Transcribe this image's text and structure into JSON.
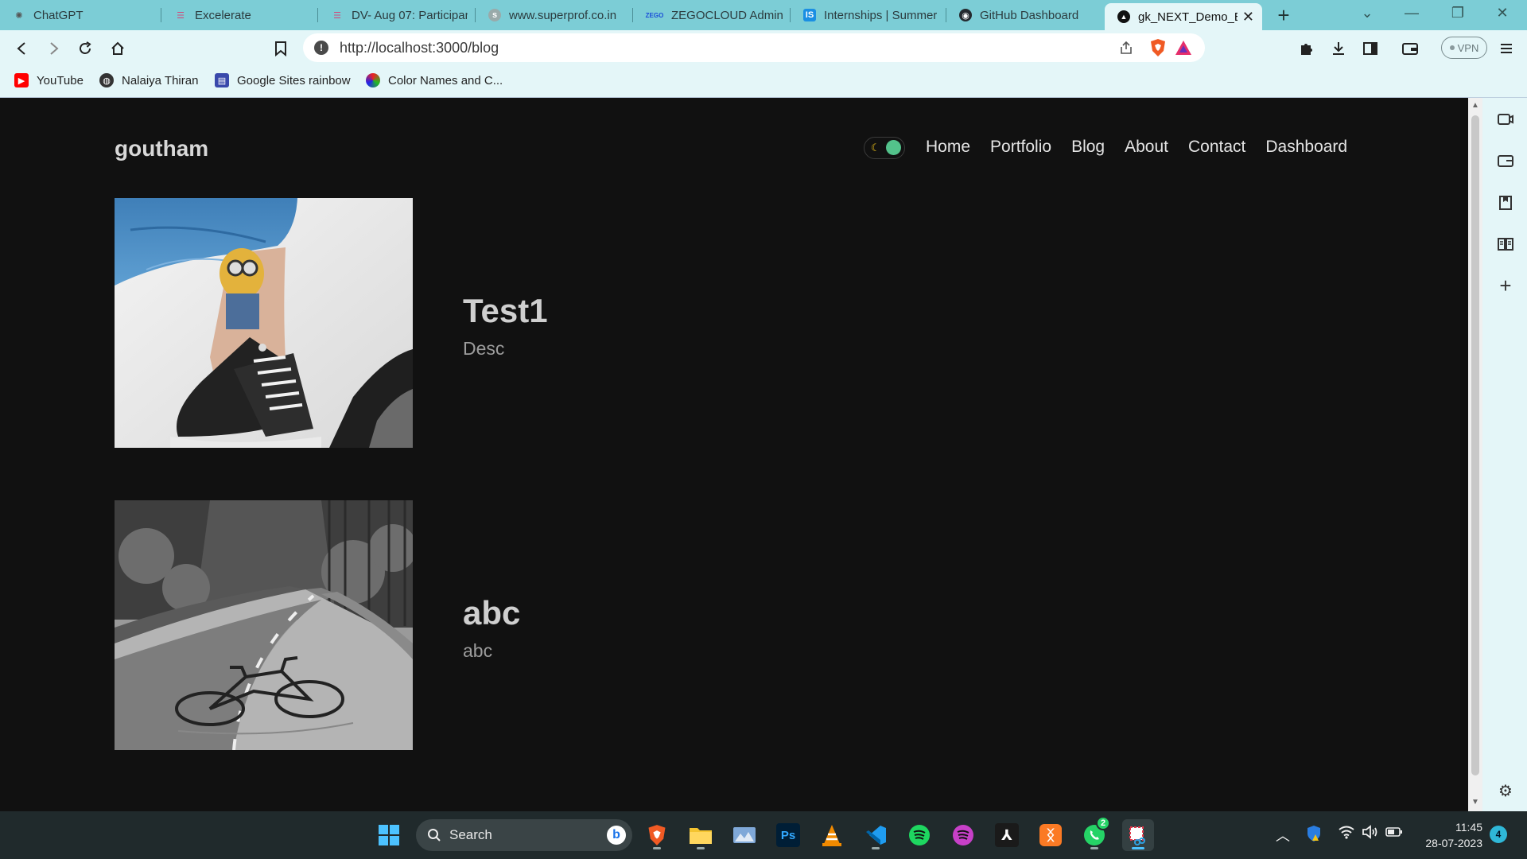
{
  "browser": {
    "tabs": [
      {
        "title": "ChatGPT",
        "icon": "chatgpt-icon"
      },
      {
        "title": "Excelerate",
        "icon": "doc-icon"
      },
      {
        "title": "DV- Aug 07: Participan",
        "icon": "form-icon"
      },
      {
        "title": "www.superprof.co.in",
        "icon": "globe-icon"
      },
      {
        "title": "ZEGOCLOUD Admin C",
        "icon": "zego-icon"
      },
      {
        "title": "Internships | Summer I",
        "icon": "internshala-icon"
      },
      {
        "title": "GitHub Dashboard",
        "icon": "github-icon"
      },
      {
        "title": "gk_NEXT_Demo_Bl",
        "icon": "nextjs-icon",
        "active": true
      }
    ],
    "address_bar": {
      "url": "http://localhost:3000/blog"
    },
    "vpn_label": "VPN",
    "bookmarks": [
      {
        "label": "YouTube",
        "icon": "youtube-icon"
      },
      {
        "label": "Nalaiya Thiran",
        "icon": "globe-icon"
      },
      {
        "label": "Google Sites rainbow",
        "icon": "sites-icon"
      },
      {
        "label": "Color Names and C...",
        "icon": "color-wheel-icon"
      }
    ]
  },
  "site": {
    "logo": "goutham",
    "nav": [
      "Home",
      "Portfolio",
      "Blog",
      "About",
      "Contact",
      "Dashboard"
    ],
    "posts": [
      {
        "title": "Test1",
        "desc": "Desc",
        "image": "minion-tattoo-sneaker-photo"
      },
      {
        "title": "abc",
        "desc": "abc",
        "image": "bicycle-on-road-photo"
      }
    ]
  },
  "taskbar": {
    "search_label": "Search",
    "time": "11:45",
    "date": "28-07-2023",
    "whatsapp_badge": "2",
    "notification_count": "4"
  }
}
